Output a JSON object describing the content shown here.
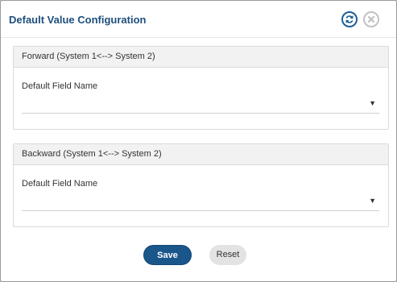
{
  "dialog": {
    "title": "Default Value Configuration",
    "refresh_icon": "refresh-icon",
    "close_icon": "close-icon"
  },
  "forward": {
    "header": "Forward (System 1<--> System 2)",
    "field_label": "Default Field Name",
    "field_value": ""
  },
  "backward": {
    "header": "Backward (System 1<--> System 2)",
    "field_label": "Default Field Name",
    "field_value": ""
  },
  "actions": {
    "save_label": "Save",
    "reset_label": "Reset"
  },
  "colors": {
    "title": "#1d4f7d",
    "primary": "#1a568a",
    "secondary": "#e3e3e3"
  }
}
